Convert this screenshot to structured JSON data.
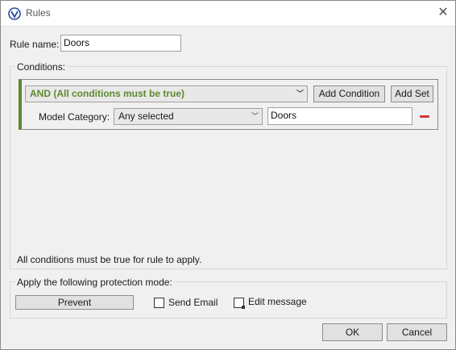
{
  "window": {
    "title": "Rules",
    "icons": {
      "app": "logo-icon",
      "close": "close-icon"
    }
  },
  "rule": {
    "name_label": "Rule name:",
    "name_value": "Doors"
  },
  "conditions": {
    "caption": "Conditions:",
    "operator_selected": "AND (All conditions must be true)",
    "operator_color": "#5c8a2e",
    "add_condition_label": "Add Condition",
    "add_set_label": "Add Set",
    "row": {
      "field_label": "Model Category:",
      "comparator_selected": "Any selected",
      "value": "Doors"
    },
    "footer_text": "All conditions must be true for rule to apply."
  },
  "protection": {
    "caption": "Apply the following protection mode:",
    "mode_button_label": "Prevent",
    "send_email_label": "Send Email",
    "send_email_checked": false,
    "edit_message_label": "Edit message"
  },
  "dialog_buttons": {
    "ok_label": "OK",
    "cancel_label": "Cancel"
  },
  "colors": {
    "remove_icon": "#d13438"
  }
}
